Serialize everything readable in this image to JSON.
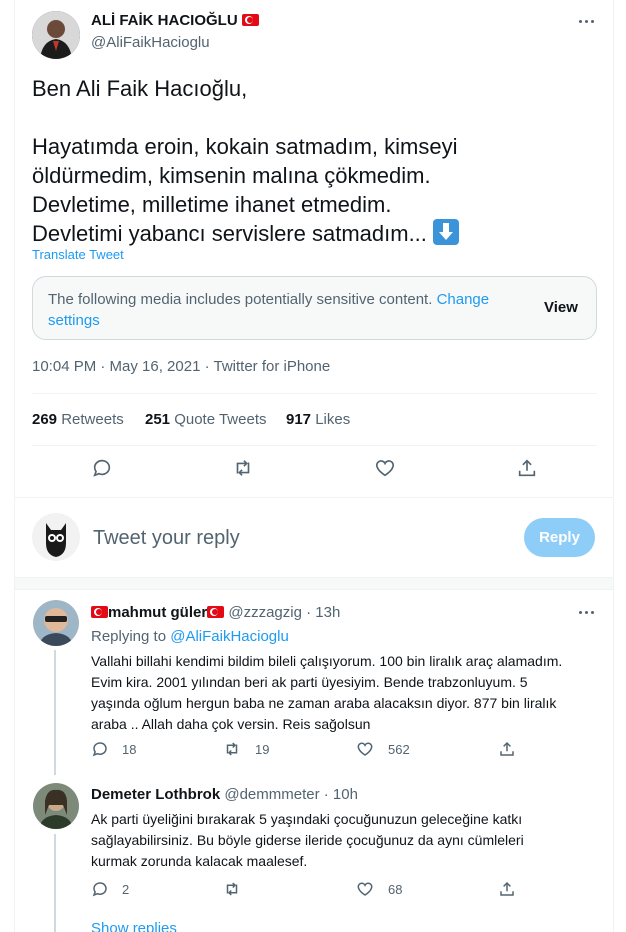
{
  "tweet": {
    "author_name": "ALİ FAİK HACIOĞLU",
    "author_handle": "@AliFaikHacioglu",
    "greeting": "Ben Ali Faik Hacıoğlu,",
    "body_lines": [
      "Hayatımda eroin, kokain satmadım, kimseyi",
      "öldürmedim, kimsenin malına çökmedim.",
      "Devletime, milletime ihanet etmedim.",
      "Devletimi yabancı servislere satmadım..."
    ],
    "translate_label": "Translate Tweet",
    "sensitive_text": "The following media includes potentially sensitive content.",
    "sensitive_link": "Change settings",
    "view_label": "View",
    "timestamp": "10:04 PM · May 16, 2021 · Twitter for iPhone",
    "stats": {
      "retweets_count": "269",
      "retweets_label": "Retweets",
      "quotes_count": "251",
      "quotes_label": "Quote Tweets",
      "likes_count": "917",
      "likes_label": "Likes"
    }
  },
  "compose": {
    "placeholder": "Tweet your reply",
    "reply_button": "Reply"
  },
  "replies": [
    {
      "name": "mahmut güler",
      "handle": "@zzzagzig · 13h",
      "replying_prefix": "Replying to",
      "replying_to": "@AliFaikHacioglu",
      "lines": [
        "Vallahi billahi kendimi bildim bileli çalışıyorum. 100 bin liralık araç alamadım.",
        "Evim kira. 2001 yılından beri ak parti üyesiyim. Bende trabzonluyum. 5",
        "yaşında oğlum hergun baba ne zaman araba alacaksın diyor. 877 bin liralık",
        "araba .. Allah daha çok versin. Reis sağolsun"
      ],
      "reply_count": "18",
      "retweet_count": "19",
      "like_count": "562"
    },
    {
      "name": "Demeter Lothbrok",
      "handle": "@demmmeter · 10h",
      "lines": [
        "Ak parti üyeliğini bırakarak 5 yaşındaki çocuğunuzun geleceğine katkı",
        "sağlayabilirsiniz. Bu böyle giderse ileride çocuğunuz da aynı cümleleri",
        "kurmak zorunda kalacak maalesef."
      ],
      "reply_count": "2",
      "retweet_count": "",
      "like_count": "68"
    }
  ],
  "show_replies": "Show replies",
  "icons": {
    "reply": "reply-icon",
    "retweet": "retweet-icon",
    "like": "heart-icon",
    "share": "share-icon",
    "more": "more-icon",
    "flag": "turkey-flag-icon",
    "emoji": "down-arrow-emoji-icon"
  },
  "colors": {
    "accent": "#1d9bf0",
    "muted": "#536471",
    "reply_button_disabled": "#8ecdf8"
  }
}
